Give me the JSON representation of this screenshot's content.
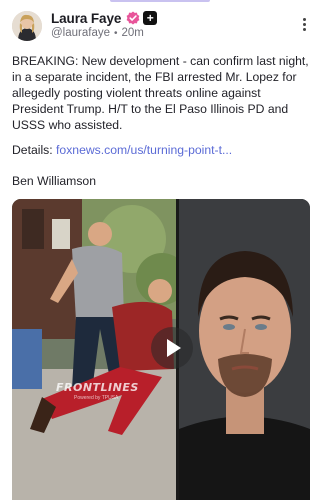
{
  "author": {
    "name": "Laura Faye",
    "handle": "@laurafaye",
    "separator": "•",
    "time": "20m",
    "verified_color": "#e8559a"
  },
  "post": {
    "text": "BREAKING: New development - can confirm last night, in a separate incident, the FBI arrested Mr. Lopez for allegedly posting violent threats online against President Trump. H/T to the El Paso Illinois PD and USSS who assisted.",
    "details_label": "Details: ",
    "details_link": "foxnews.com/us/turning-point-t...",
    "signoff": "Ben Williamson"
  },
  "media": {
    "watermark": "FRONTLINES",
    "watermark_sub": "Powered by TPUSA"
  },
  "colors": {
    "link": "#5b6bd6",
    "accent_bar": "#c9c2f0"
  }
}
